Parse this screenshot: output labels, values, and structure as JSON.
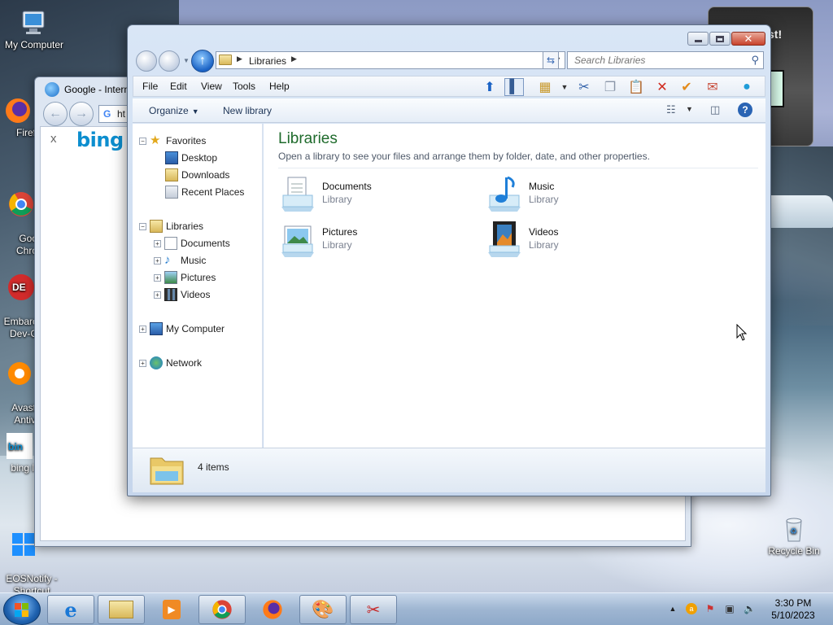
{
  "desktop": {
    "icons_left": [
      {
        "label": "My Computer"
      },
      {
        "label": "Firef"
      },
      {
        "label": "Goo\nChro"
      },
      {
        "label": "Embarc\nDev-C"
      },
      {
        "label": "Avast\nAntiv"
      },
      {
        "label": "bing l"
      },
      {
        "label": "EOSNotify -\nShortcut"
      }
    ],
    "recycle_bin": "Recycle Bin",
    "gadget_text": "st!"
  },
  "ie_window": {
    "title": "Google - Intern",
    "address_prefix": "ht",
    "tab_close": "x",
    "bing_logo": "bing"
  },
  "explorer": {
    "address": {
      "crumb": "Libraries",
      "search_placeholder": "Search Libraries"
    },
    "menu": [
      "File",
      "Edit",
      "View",
      "Tools",
      "Help"
    ],
    "commands": {
      "organize": "Organize",
      "new_library": "New library"
    },
    "nav_tree": {
      "favorites": {
        "label": "Favorites",
        "items": [
          "Desktop",
          "Downloads",
          "Recent Places"
        ]
      },
      "libraries": {
        "label": "Libraries",
        "items": [
          "Documents",
          "Music",
          "Pictures",
          "Videos"
        ]
      },
      "my_computer": "My Computer",
      "network": "Network"
    },
    "content": {
      "title": "Libraries",
      "subtitle": "Open a library to see your files and arrange them by folder, date, and other properties.",
      "libraries": [
        {
          "name": "Documents",
          "kind": "Library",
          "icon": "documents-library-icon"
        },
        {
          "name": "Music",
          "kind": "Library",
          "icon": "music-library-icon"
        },
        {
          "name": "Pictures",
          "kind": "Library",
          "icon": "pictures-library-icon"
        },
        {
          "name": "Videos",
          "kind": "Library",
          "icon": "videos-library-icon"
        }
      ]
    },
    "details": {
      "item_count": "4 items"
    }
  },
  "taskbar": {
    "pinned": [
      "internet-explorer",
      "windows-explorer",
      "media-player",
      "chrome",
      "firefox",
      "paint",
      "snipping-tool"
    ],
    "clock_time": "3:30 PM",
    "clock_date": "5/10/2023"
  }
}
